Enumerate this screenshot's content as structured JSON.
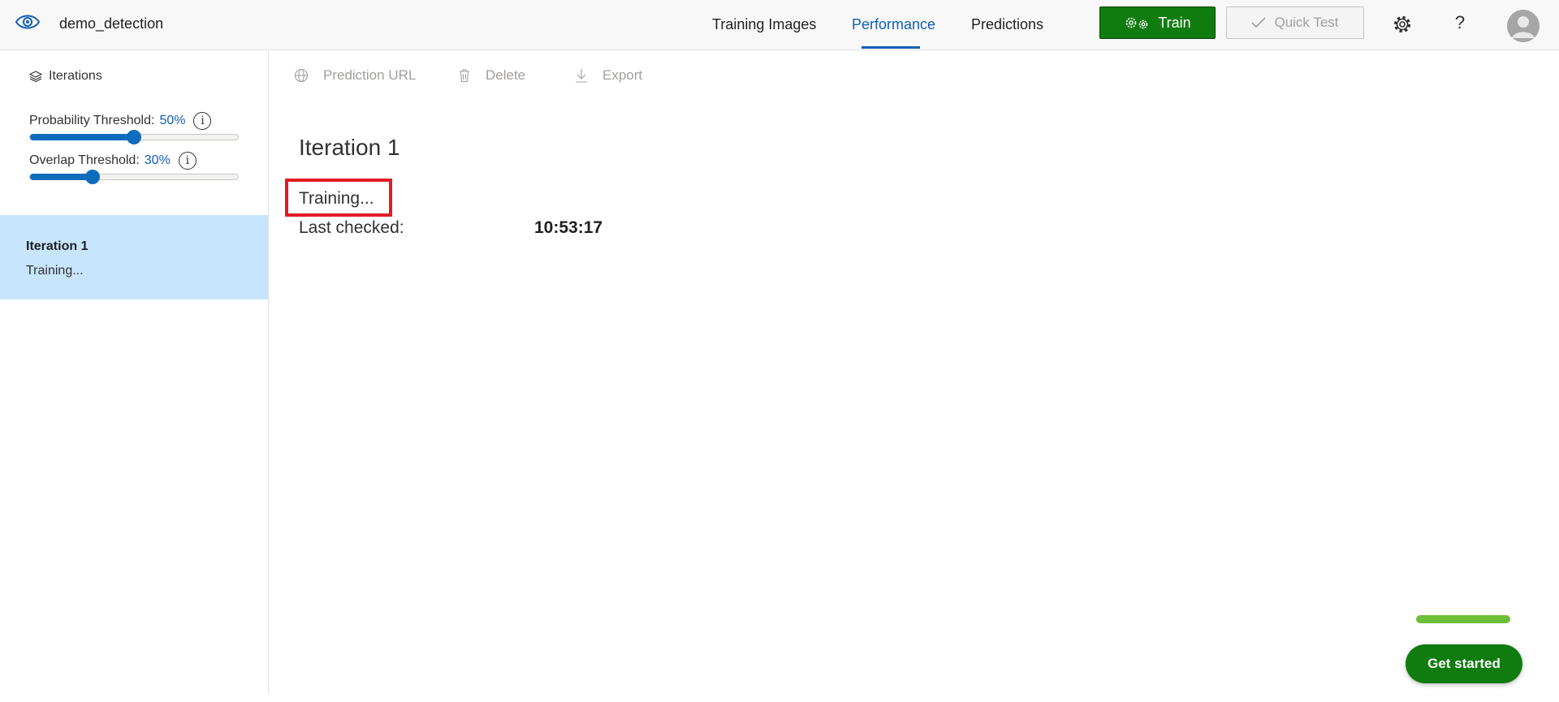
{
  "header": {
    "project_name": "demo_detection",
    "tabs": [
      {
        "label": "Training Images",
        "active": false
      },
      {
        "label": "Performance",
        "active": true
      },
      {
        "label": "Predictions",
        "active": false
      }
    ],
    "train_label": "Train",
    "quick_test_label": "Quick Test",
    "help_glyph": "?",
    "icons": [
      "eye-icon",
      "gears-icon",
      "check-icon",
      "gear-icon",
      "help-icon",
      "avatar"
    ]
  },
  "sidebar": {
    "iterations_label": "Iterations",
    "probability": {
      "label": "Probability Threshold:",
      "value_text": "50%",
      "value": 0.5
    },
    "overlap": {
      "label": "Overlap Threshold:",
      "value_text": "30%",
      "value": 0.3
    },
    "info_glyph": "i",
    "items": [
      {
        "title": "Iteration 1",
        "status": "Training..."
      }
    ]
  },
  "toolbar": {
    "prediction_url": "Prediction URL",
    "delete": "Delete",
    "export": "Export"
  },
  "main": {
    "iteration_title": "Iteration 1",
    "status": "Training...",
    "last_checked_label": "Last checked:",
    "last_checked_value": "10:53:17"
  },
  "get_started": {
    "label": "Get started"
  },
  "colors": {
    "accent": "#0f5fb8",
    "train_green": "#107c10",
    "selected_bg": "#c7e5fd",
    "highlight_red": "#e31b23"
  }
}
